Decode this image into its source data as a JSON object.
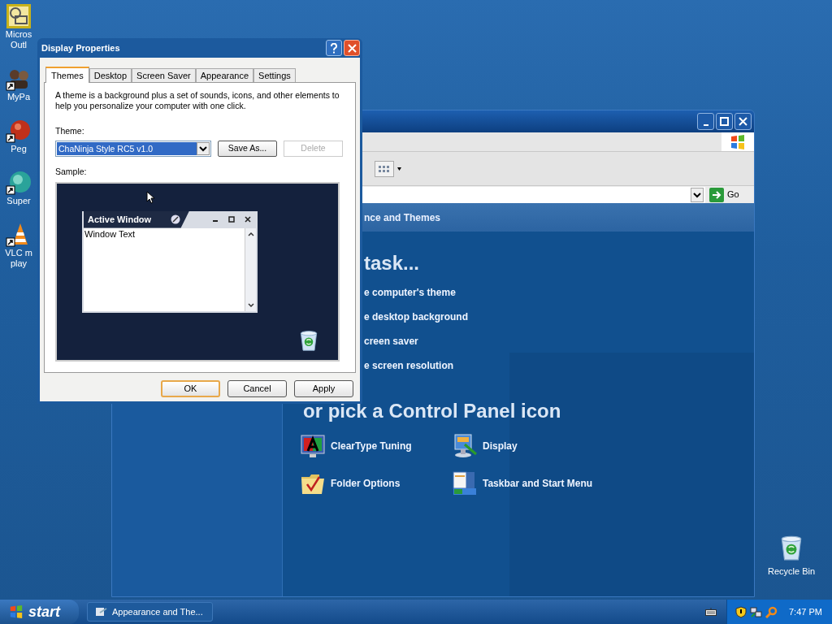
{
  "desktop_icons": [
    {
      "kind": "outlook",
      "lines": [
        "Micros",
        "Outl"
      ]
    },
    {
      "kind": "people",
      "lines": [
        "MyPa"
      ]
    },
    {
      "kind": "ball",
      "lines": [
        "Peg"
      ]
    },
    {
      "kind": "globe",
      "lines": [
        "Super"
      ]
    },
    {
      "kind": "cone",
      "lines": [
        "VLC m",
        "play"
      ]
    }
  ],
  "recycle_bin": {
    "label": "Recycle Bin"
  },
  "control_panel": {
    "go_label": "Go",
    "header": "nce and Themes",
    "task_heading": "task...",
    "tasks": [
      "e computer's theme",
      "e desktop background",
      "creen saver",
      "e screen resolution"
    ],
    "icon_heading": "or pick a Control Panel icon",
    "icons": [
      {
        "kind": "cleartype",
        "label": "ClearType Tuning"
      },
      {
        "kind": "display",
        "label": "Display"
      },
      {
        "kind": "folder",
        "label": "Folder Options"
      },
      {
        "kind": "taskbar",
        "label": "Taskbar and Start Menu"
      }
    ]
  },
  "dialog": {
    "title": "Display Properties",
    "tabs": [
      {
        "label": "Themes",
        "selected": true
      },
      {
        "label": "Desktop",
        "selected": false
      },
      {
        "label": "Screen Saver",
        "selected": false
      },
      {
        "label": "Appearance",
        "selected": false
      },
      {
        "label": "Settings",
        "selected": false
      }
    ],
    "description": "A theme is a background plus a set of sounds, icons, and other elements to help you personalize your computer with one click.",
    "theme_label": "Theme:",
    "theme_value": "ChaNinja Style RC5 v1.0",
    "side_buttons": [
      {
        "label": "Save As...",
        "disabled": false
      },
      {
        "label": "Delete",
        "disabled": true
      }
    ],
    "sample_label": "Sample:",
    "sample": {
      "title": "Active Window",
      "text": "Window Text"
    },
    "buttons": [
      {
        "label": "OK",
        "default": true
      },
      {
        "label": "Cancel",
        "default": false
      },
      {
        "label": "Apply",
        "default": false
      }
    ]
  },
  "taskbar": {
    "start": "start",
    "tasks": [
      "Appearance and The..."
    ],
    "clock": "7:47 PM"
  }
}
